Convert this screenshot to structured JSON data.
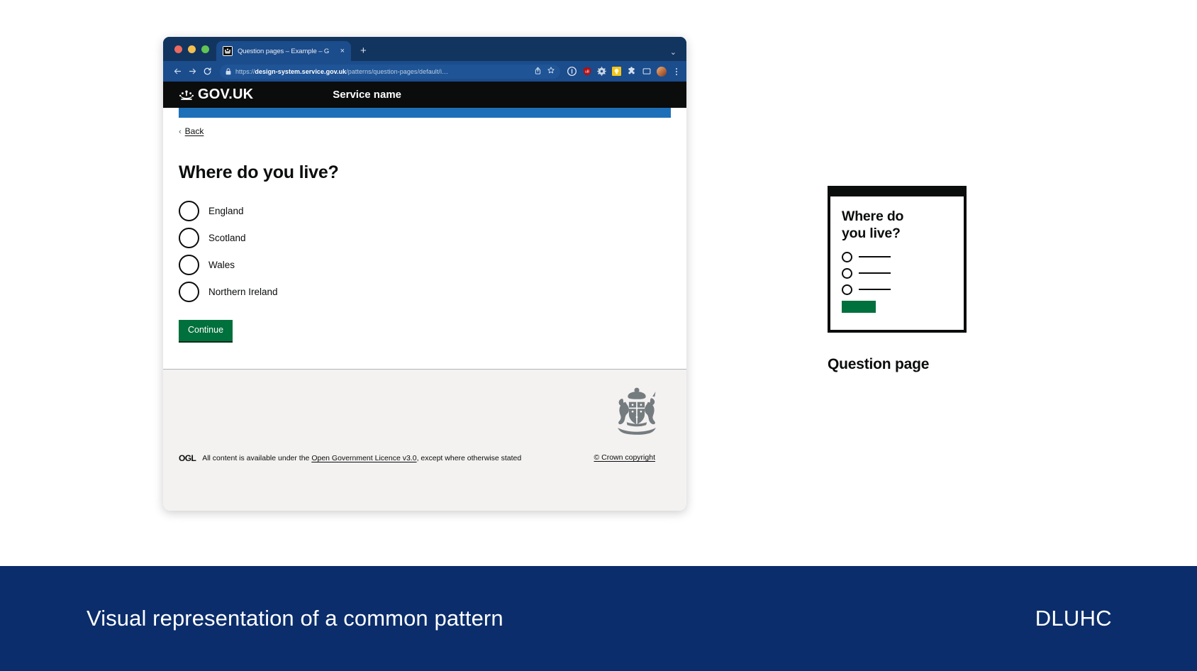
{
  "browser": {
    "tab": {
      "title_main": "Question pages – Example – G",
      "favicon": "govuk-crown-favicon",
      "close_label": "×"
    },
    "new_tab_label": "+",
    "window_chevron": "⌄",
    "toolbar": {
      "back_label": "←",
      "forward_label": "→",
      "reload_label": "⟳",
      "url_scheme": "https://",
      "url_domain": "design-system.service.gov.uk",
      "url_path": "/patterns/question-pages/default/i…",
      "lock_icon": "lock-icon",
      "share_icon": "share-icon",
      "bookmark_icon": "star-icon",
      "extensions": [
        "onepassword-icon",
        "ublock-origin-icon",
        "gear-extension-icon",
        "lightbulb-extension-icon",
        "puzzle-extensions-icon",
        "cast-icon"
      ],
      "profile_icon": "profile-avatar",
      "menu_icon": "kebab-menu-icon"
    }
  },
  "page": {
    "header": {
      "logo_text": "GOV.UK",
      "crown_icon": "govuk-crown-icon",
      "service_name": "Service name"
    },
    "back_link": {
      "chevron": "‹",
      "label": "Back"
    },
    "heading": "Where do you live?",
    "radios": [
      {
        "label": "England"
      },
      {
        "label": "Scotland"
      },
      {
        "label": "Wales"
      },
      {
        "label": "Northern Ireland"
      }
    ],
    "continue_button": "Continue",
    "footer": {
      "ogl_badge": "OGL",
      "licence_prefix": "All content is available under the ",
      "licence_link": "Open Government Licence v3.0",
      "licence_suffix": ", except where otherwise stated",
      "crown_copyright": "© Crown copyright",
      "crest_icon": "royal-coat-of-arms-icon"
    }
  },
  "thumbnail": {
    "title": "Where do\nyou live?",
    "title_line1": "Where do",
    "title_line2": "you live?",
    "rows": 3,
    "caption": "Question page"
  },
  "banner": {
    "text": "Visual representation of a common pattern",
    "brand": "DLUHC"
  },
  "colors": {
    "govuk_black": "#0b0c0c",
    "govuk_blue": "#1d70b8",
    "govuk_green": "#00703c",
    "banner_navy": "#0b2d6b",
    "browser_navy": "#12355f",
    "footer_grey": "#f3f2f1"
  }
}
